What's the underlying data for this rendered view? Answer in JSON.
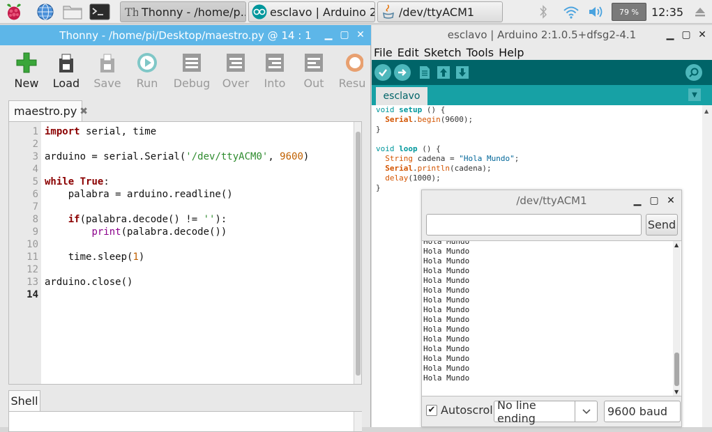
{
  "taskbar": {
    "tasks": [
      {
        "label": "Thonny  -  /home/p..."
      },
      {
        "label": "esclavo | Arduino 2..."
      },
      {
        "label": "/dev/ttyACM1"
      }
    ],
    "battery": "79 %",
    "clock": "12:35"
  },
  "thonny": {
    "title": "Thonny  -  /home/pi/Desktop/maestro.py  @  14 : 1",
    "toolbar": [
      "New",
      "Load",
      "Save",
      "Run",
      "Debug",
      "Over",
      "Into",
      "Out",
      "Resu"
    ],
    "tab": "maestro.py",
    "line_numbers": [
      "1",
      "2",
      "3",
      "4",
      "5",
      "6",
      "7",
      "8",
      "9",
      "10",
      "11",
      "12",
      "13",
      "14"
    ],
    "code": {
      "l1_kw": "import",
      "l1_rest": " serial, time",
      "l3_a": "arduino = serial.Serial(",
      "l3_str": "'/dev/ttyACM0'",
      "l3_b": ", ",
      "l3_num": "9600",
      "l3_c": ")",
      "l5_kw": "while",
      "l5_sp": " ",
      "l5_true": "True",
      "l5_colon": ":",
      "l6": "    palabra = arduino.readline()",
      "l8_ind": "    ",
      "l8_kw": "if",
      "l8_a": "(palabra.decode() != ",
      "l8_str": "''",
      "l8_b": "):",
      "l9_ind": "        ",
      "l9_print": "print",
      "l9_rest": "(palabra.decode())",
      "l11_a": "    time.sleep(",
      "l11_num": "1",
      "l11_b": ")",
      "l13": "arduino.close()"
    },
    "shell_tab": "Shell"
  },
  "arduino": {
    "title": "esclavo | Arduino 2:1.0.5+dfsg2-4.1",
    "menu": [
      "File",
      "Edit",
      "Sketch",
      "Tools",
      "Help"
    ],
    "tab": "esclavo",
    "code": {
      "l1_void": "void",
      "l1_sp": " ",
      "l1_fn": "setup",
      "l1_rest": " () {",
      "l2_ind": "  ",
      "l2_cls": "Serial",
      "l2_dot": ".",
      "l2_fn": "begin",
      "l2_rest": "(9600);",
      "l3": "}",
      "l5_void": "void",
      "l5_sp": " ",
      "l5_fn": "loop",
      "l5_rest": " () {",
      "l6_ind": "  ",
      "l6_type": "String",
      "l6_a": " cadena = ",
      "l6_str": "\"Hola Mundo\"",
      "l6_b": ";",
      "l7_ind": "  ",
      "l7_cls": "Serial",
      "l7_dot": ".",
      "l7_fn": "println",
      "l7_rest": "(cadena);",
      "l8_ind": "  ",
      "l8_fn": "delay",
      "l8_rest": "(1000);",
      "l9": "}"
    }
  },
  "serial": {
    "title": "/dev/ttyACM1",
    "input_value": "",
    "send": "Send",
    "output": [
      "Hola Mundo",
      "Hola Mundo",
      "Hola Mundo",
      "Hola Mundo",
      "Hola Mundo",
      "Hola Mundo",
      "Hola Mundo",
      "Hola Mundo",
      "Hola Mundo",
      "Hola Mundo",
      "Hola Mundo",
      "Hola Mundo",
      "Hola Mundo",
      "Hola Mundo",
      "Hola Mundo"
    ],
    "autoscroll_label": "Autoscroll",
    "autoscroll_checked": true,
    "line_ending": "No line ending",
    "baud": "9600 baud"
  }
}
